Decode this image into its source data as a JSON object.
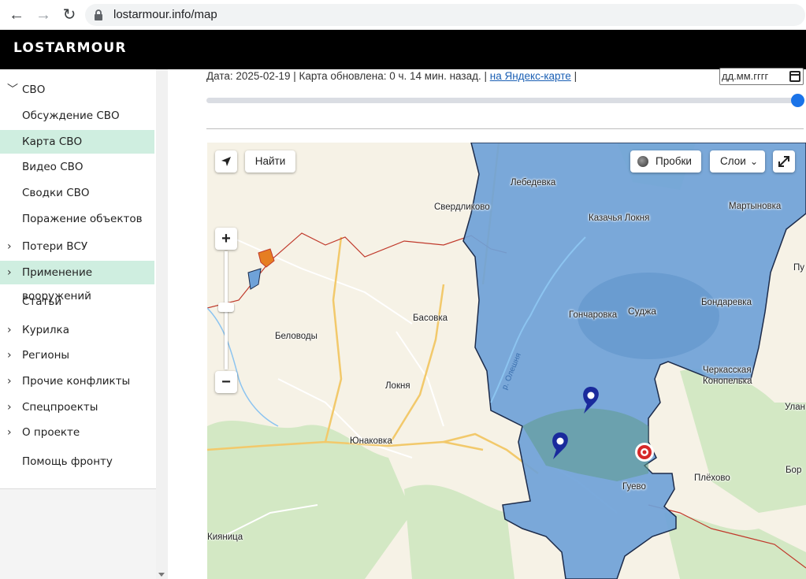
{
  "browser": {
    "url": "lostarmour.info/map",
    "back_icon": "←",
    "forward_icon": "→",
    "reload_icon": "↻"
  },
  "header": {
    "logo": "LOSTARMOUR"
  },
  "sidebar": {
    "items": [
      {
        "label": "СВО",
        "expanded": true
      },
      {
        "label": "Обсуждение СВО"
      },
      {
        "label": "Карта СВО",
        "active": true
      },
      {
        "label": "Видео СВО"
      },
      {
        "label": "Сводки СВО"
      },
      {
        "label": "Поражение объектов"
      },
      {
        "label": "Потери ВСУ"
      },
      {
        "label": "Применение вооружений",
        "active": true
      },
      {
        "label": "Статьи"
      },
      {
        "label": "Курилка"
      },
      {
        "label": "Регионы"
      },
      {
        "label": "Прочие конфликты"
      },
      {
        "label": "Спецпроекты"
      },
      {
        "label": "О проекте"
      },
      {
        "label": "Помощь фронту"
      }
    ]
  },
  "content": {
    "info_text": "Дата: 2025-02-19 | Карта обновлена: 0 ч. 14 мин. назад. | ",
    "yandex_link": "на Яндекс-карте",
    "info_tail": " |",
    "date_placeholder": "дд.мм.гггг",
    "slider_position": 1.0
  },
  "map": {
    "controls": {
      "find": "Найти",
      "traffic": "Пробки",
      "layers": "Слои",
      "zoom_in": "+",
      "zoom_out": "−"
    },
    "places": {
      "lebedevka": "Лебедевка",
      "sverdlikovo": "Свердликово",
      "kazachya_lokhnya": "Казачья Локня",
      "martynovka": "Мартыновка",
      "belovody": "Беловоды",
      "basovka": "Басовка",
      "goncharovka": "Гончаровка",
      "sudzha": "Суджа",
      "bondarevka": "Бондаревка",
      "cherkasskaya": "Черкасская",
      "konopelka": "Конопелька",
      "lokhnya": "Локня",
      "yunakovka": "Юнаковка",
      "plekhovo": "Плёхово",
      "guevo": "Гуево",
      "kiyanitsa": "Кияница",
      "p_cut": "Пу",
      "ulan_cut": "Улан",
      "bor_cut": "Бор"
    },
    "river": "р. Олешня",
    "colors": {
      "occupied": "#6fa2d8",
      "background": "#f6f2e6",
      "forest": "#cfe6c0",
      "roads": "#f2c96b",
      "border": "#c0392b"
    }
  }
}
